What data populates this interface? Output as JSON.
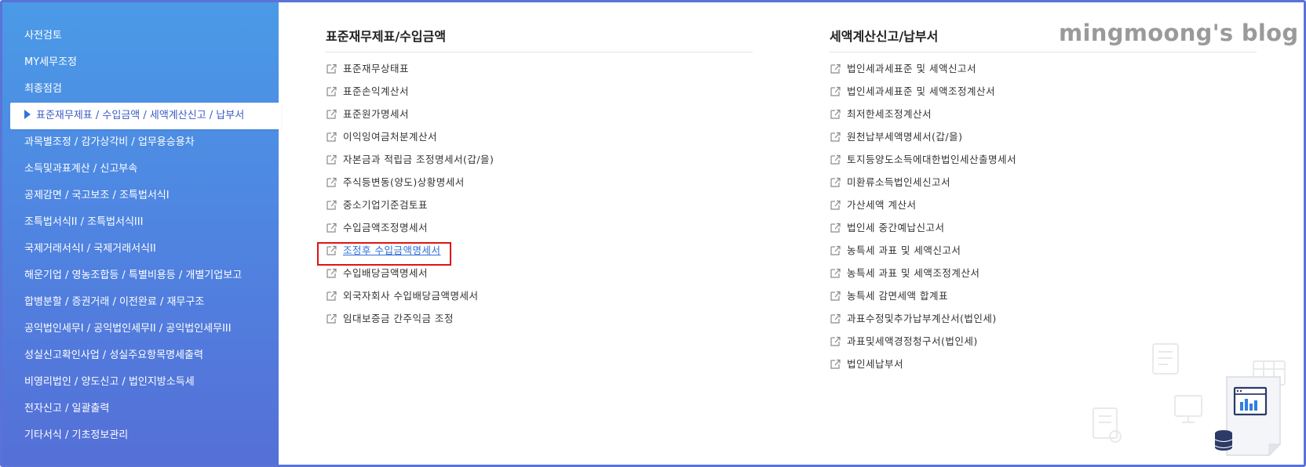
{
  "sidebar": {
    "items": [
      {
        "label": "사전검토"
      },
      {
        "label": "MY세무조정"
      },
      {
        "label": "최종점검"
      },
      {
        "label": "표준재무제표 / 수입금액 / 세액계산신고 / 납부서",
        "active": true
      },
      {
        "label": "과목별조정 / 감가상각비 / 업무용승용차"
      },
      {
        "label": "소득및과표계산 / 신고부속"
      },
      {
        "label": "공제감면 / 국고보조 / 조특법서식I"
      },
      {
        "label": "조특법서식II / 조특법서식III"
      },
      {
        "label": "국제거래서식I / 국제거래서식II"
      },
      {
        "label": "해운기업 / 영농조합등 / 특별비용등 / 개별기업보고"
      },
      {
        "label": "합병분할 / 증권거래 / 이전완료 / 재무구조"
      },
      {
        "label": "공익법인세무I / 공익법인세무II / 공익법인세무III"
      },
      {
        "label": "성실신고확인사업 / 성실주요항목명세출력"
      },
      {
        "label": "비영리법인 / 양도신고 / 법인지방소득세"
      },
      {
        "label": "전자신고 / 일괄출력"
      },
      {
        "label": "기타서식 / 기초정보관리"
      }
    ]
  },
  "left_column": {
    "title": "표준재무제표/수입금액",
    "links": [
      {
        "label": "표준재무상태표"
      },
      {
        "label": "표준손익계산서"
      },
      {
        "label": "표준원가명세서"
      },
      {
        "label": "이익잉여금처분계산서"
      },
      {
        "label": "자본금과 적립금 조정명세서(갑/을)"
      },
      {
        "label": "주식등변동(양도)상황명세서"
      },
      {
        "label": "중소기업기준검토표"
      },
      {
        "label": "수입금액조정명세서"
      },
      {
        "label": "조정후 수입금액명세서",
        "highlighted": true
      },
      {
        "label": "수입배당금액명세서"
      },
      {
        "label": "외국자회사 수입배당금액명세서"
      },
      {
        "label": "임대보증금 간주익금 조정"
      }
    ]
  },
  "right_column": {
    "title": "세액계산신고/납부서",
    "links": [
      {
        "label": "법인세과세표준 및 세액신고서"
      },
      {
        "label": "법인세과세표준 및 세액조정계산서"
      },
      {
        "label": "최저한세조정계산서"
      },
      {
        "label": "원천납부세액명세서(갑/을)"
      },
      {
        "label": "토지등양도소득에대한법인세산출명세서"
      },
      {
        "label": "미환류소득법인세신고서"
      },
      {
        "label": "가산세액 계산서"
      },
      {
        "label": "법인세 중간예납신고서"
      },
      {
        "label": "농특세 과표 및 세액신고서"
      },
      {
        "label": "농특세 과표 및 세액조정계산서"
      },
      {
        "label": "농특세 감면세액 합계표"
      },
      {
        "label": "과표수정및추가납부계산서(법인세)"
      },
      {
        "label": "과표및세액경정청구서(법인세)"
      },
      {
        "label": "법인세납부서"
      }
    ]
  },
  "watermark": "mingmoong's blog",
  "colors": {
    "sidebar_top": "#4a9ae6",
    "sidebar_bottom": "#556fd6",
    "highlight_box": "#e01414",
    "link_highlight": "#2f6fd8"
  },
  "icons": {
    "link": "external-link-icon",
    "active_marker": "triangle-right-icon"
  }
}
